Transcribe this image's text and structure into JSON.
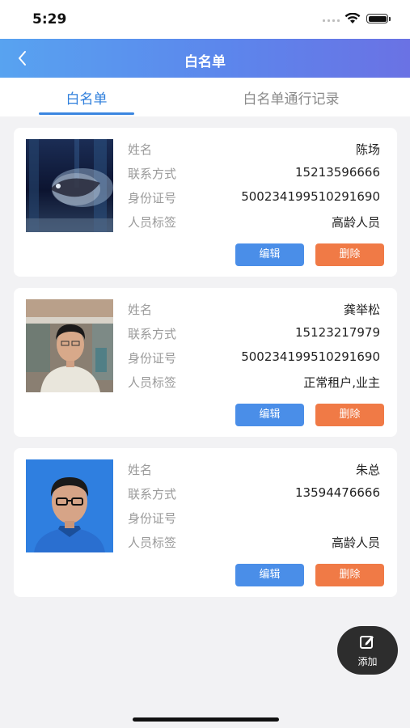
{
  "status_bar": {
    "time": "5:29"
  },
  "header": {
    "title": "白名单",
    "back_icon": "chevron-left-icon"
  },
  "tabs": [
    {
      "label": "白名单",
      "active": true
    },
    {
      "label": "白名单通行记录",
      "active": false
    }
  ],
  "field_labels": {
    "name": "姓名",
    "phone": "联系方式",
    "id_number": "身份证号",
    "tags": "人员标签"
  },
  "people": [
    {
      "name": "陈场",
      "phone": "15213596666",
      "id_number": "500234199510291690",
      "tags": "高龄人员",
      "photo": "aquarium-fish-photo"
    },
    {
      "name": "龚举松",
      "phone": "15123217979",
      "id_number": "500234199510291690",
      "tags": "正常租户,业主",
      "photo": "man-selfie-photo"
    },
    {
      "name": "朱总",
      "phone": "13594476666",
      "id_number": "",
      "tags": "高龄人员",
      "photo": "man-blue-background-portrait"
    }
  ],
  "actions": {
    "edit_label": "编辑",
    "delete_label": "删除"
  },
  "fab": {
    "label": "添加",
    "icon": "edit-icon"
  },
  "colors": {
    "accent": "#3b86e0",
    "edit_button": "#4a8ee8",
    "delete_button": "#f07a46",
    "header_gradient_start": "#58a3f0",
    "header_gradient_end": "#6a72e4"
  }
}
